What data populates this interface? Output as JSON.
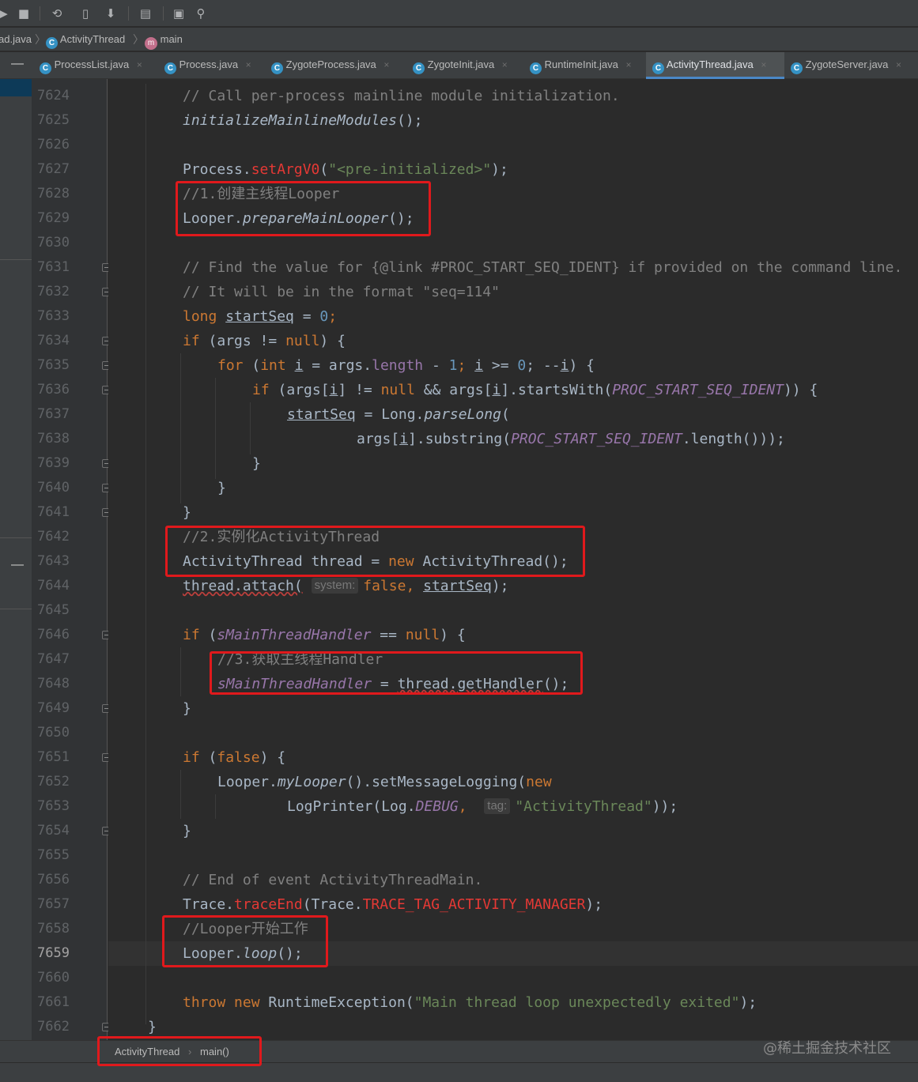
{
  "breadcrumb": {
    "file": "ad.java",
    "class": "ActivityThread",
    "method": "main"
  },
  "tabs": [
    {
      "label": "ProcessList.java"
    },
    {
      "label": "Process.java"
    },
    {
      "label": "ZygoteProcess.java"
    },
    {
      "label": "ZygoteInit.java"
    },
    {
      "label": "RuntimeInit.java"
    },
    {
      "label": "ActivityThread.java",
      "active": true
    },
    {
      "label": "ZygoteServer.java"
    }
  ],
  "tab_close": "×",
  "line_numbers": [
    "7624",
    "7625",
    "7626",
    "7627",
    "7628",
    "7629",
    "7630",
    "7631",
    "7632",
    "7633",
    "7634",
    "7635",
    "7636",
    "7637",
    "7638",
    "7639",
    "7640",
    "7641",
    "7642",
    "7643",
    "7644",
    "7645",
    "7646",
    "7647",
    "7648",
    "7649",
    "7650",
    "7651",
    "7652",
    "7653",
    "7654",
    "7655",
    "7656",
    "7657",
    "7658",
    "7659",
    "7660",
    "7661",
    "7662"
  ],
  "current_line": "7659",
  "code": {
    "l7624": "// Call per-process mainline module initialization.",
    "l7625_fn": "initializeMainlineModules",
    "l7625_rest": "();",
    "l7627_a": "Process.",
    "l7627_b": "setArgV0",
    "l7627_c": "(",
    "l7627_d": "\"<pre-initialized>\"",
    "l7627_e": ");",
    "l7628": "//1.创建主线程Looper",
    "l7629_a": "Looper.",
    "l7629_b": "prepareMainLooper",
    "l7629_c": "();",
    "l7631": "// Find the value for {@link #PROC_START_SEQ_IDENT} if provided on the command line.",
    "l7632": "// It will be in the format \"seq=114\"",
    "l7633_kw": "long",
    "l7633_var": "startSeq",
    "l7633_eq": " = ",
    "l7633_num": "0",
    "l7633_end": ";",
    "l7634_kw": "if",
    "l7634_a": " (args != ",
    "l7634_null": "null",
    "l7634_b": ") {",
    "l7635_for": "for",
    "l7635_a": " (",
    "l7635_int": "int",
    "l7635_i": "i",
    "l7635_b": " = args.",
    "l7635_len": "length",
    "l7635_c": " - ",
    "l7635_one": "1",
    "l7635_d": "; ",
    "l7635_i2": "i",
    "l7635_e": " >= ",
    "l7635_zero": "0",
    "l7635_f": "; --",
    "l7635_i3": "i",
    "l7635_g": ") {",
    "l7636_if": "if",
    "l7636_a": " (args[",
    "l7636_i": "i",
    "l7636_b": "] != ",
    "l7636_null": "null",
    "l7636_c": " && args[",
    "l7636_i2": "i",
    "l7636_d": "].startsWith(",
    "l7636_const": "PROC_START_SEQ_IDENT",
    "l7636_e": ")) {",
    "l7637_var": "startSeq",
    "l7637_a": " = Long.",
    "l7637_fn": "parseLong",
    "l7637_b": "(",
    "l7638_a": "args[",
    "l7638_i": "i",
    "l7638_b": "].substring(",
    "l7638_const": "PROC_START_SEQ_IDENT",
    "l7638_c": ".length()));",
    "brace_close": "}",
    "l7642": "//2.实例化ActivityThread",
    "l7643_a": "ActivityThread thread = ",
    "l7643_new": "new",
    "l7643_b": " ActivityThread();",
    "l7644_a": "thread.attach(",
    "l7644_hint": "system:",
    "l7644_false": "false",
    "l7644_b": ", ",
    "l7644_var": "startSeq",
    "l7644_c": ");",
    "l7646_if": "if",
    "l7646_a": " (",
    "l7646_const": "sMainThreadHandler",
    "l7646_b": " == ",
    "l7646_null": "null",
    "l7646_c": ") {",
    "l7647": "//3.获取主线程Handler",
    "l7648_const": "sMainThreadHandler",
    "l7648_a": " = ",
    "l7648_b": "thread.getHandler",
    "l7648_c": "();",
    "l7651_if": "if",
    "l7651_a": " (",
    "l7651_false": "false",
    "l7651_b": ") {",
    "l7652_a": "Looper.",
    "l7652_fn": "myLooper",
    "l7652_b": "().setMessageLogging(",
    "l7652_new": "new",
    "l7653_a": "LogPrinter(Log.",
    "l7653_const": "DEBUG",
    "l7653_b": ", ",
    "l7653_hint": "tag:",
    "l7653_str": "\"ActivityThread\"",
    "l7653_c": "));",
    "l7656": "// End of event ActivityThreadMain.",
    "l7657_a": "Trace.",
    "l7657_fn": "traceEnd",
    "l7657_b": "(Trace.",
    "l7657_const": "TRACE_TAG_ACTIVITY_MANAGER",
    "l7657_c": ");",
    "l7658": "//Looper开始工作",
    "l7659_a": "Looper.",
    "l7659_fn": "loop",
    "l7659_b": "();",
    "l7661_throw": "throw",
    "l7661_new": "new",
    "l7661_a": " RuntimeException(",
    "l7661_str": "\"Main thread loop unexpectedly exited\"",
    "l7661_b": ");"
  },
  "bottom_breadcrumb": {
    "class": "ActivityThread",
    "sep": "›",
    "method": "main()"
  },
  "watermark": "@稀土掘金技术社区",
  "colors": {
    "highlight": "#e0191c",
    "keyword": "#cc7832",
    "comment": "#808080",
    "string": "#6a8759",
    "number": "#6897bb",
    "static_field": "#9876aa"
  }
}
